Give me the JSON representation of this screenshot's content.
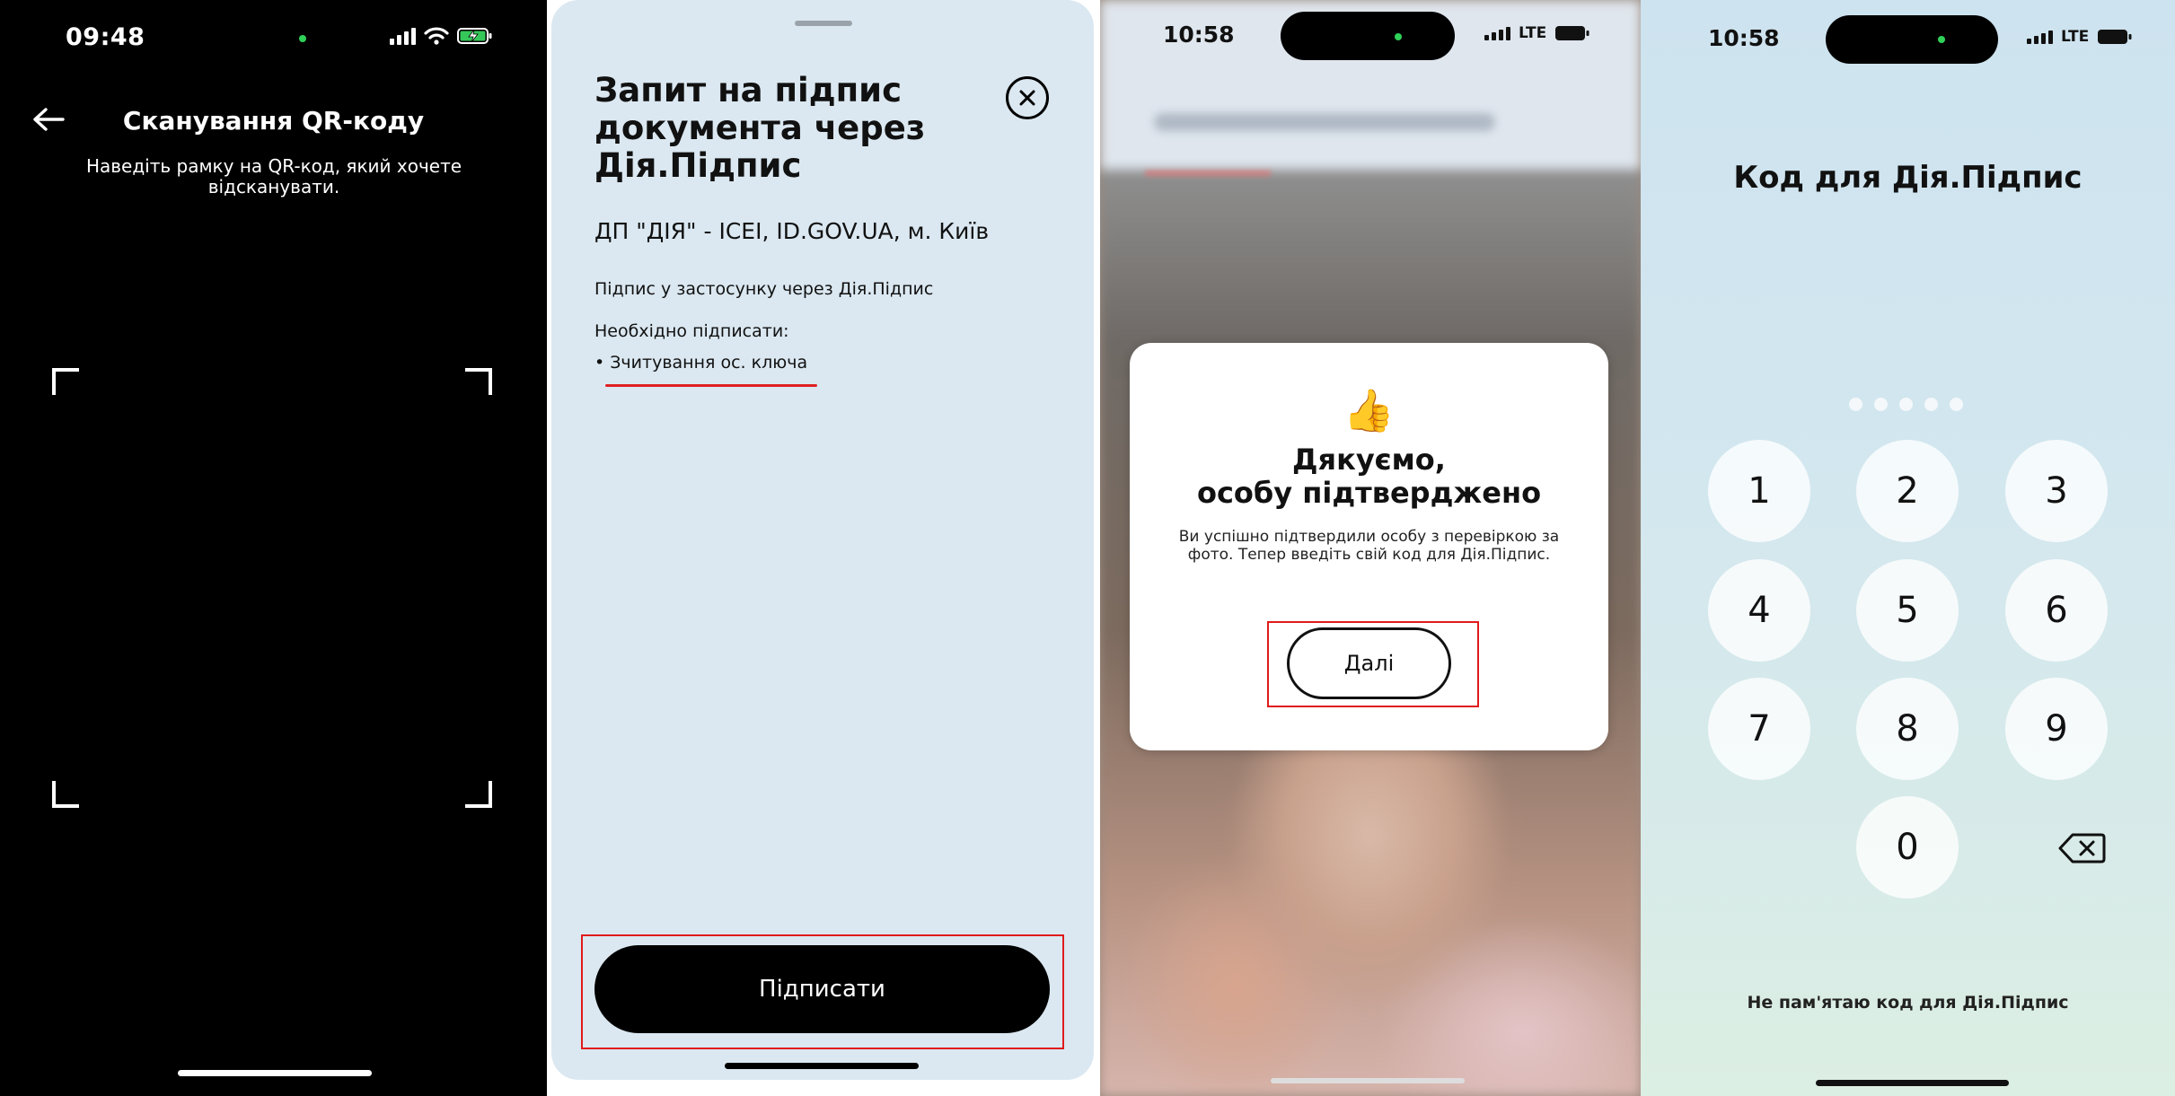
{
  "scan_screen": {
    "time": "09:48",
    "title": "Сканування QR-коду",
    "hint": "Наведіть рамку на QR-код, який хочете відсканувати.",
    "icons": {
      "back": "arrow-left-icon",
      "signal": "signal-icon",
      "wifi": "wifi-icon",
      "battery": "battery-charging-icon"
    }
  },
  "sign_request": {
    "title": "Запит на підпис документа через Дія.Підпис",
    "organization": "ДП \"ДІЯ\" - ICEI, ID.GOV.UA, м. Київ",
    "description": "Підпис у застосунку через Дія.Підпис",
    "need_to_sign_label": "Необхідно підписати:",
    "items": [
      "• Зчитування ос. ключа"
    ],
    "sign_button": "Підписати",
    "icons": {
      "close": "close-circle-icon"
    },
    "highlight_color": "#e01b1b"
  },
  "photo_check": {
    "time": "10:58",
    "network": "LTE",
    "emoji": "👍",
    "heading_line1": "Дякуємо,",
    "heading_line2": "особу підтверджено",
    "body": "Ви успішно підтвердили особу з перевіркою за фото. Тепер введіть свій код для Дія.Підпис.",
    "next_button": "Далі"
  },
  "pin_screen": {
    "time": "10:58",
    "network": "LTE",
    "title": "Код для Дія.Підпис",
    "pin_length": 5,
    "keys": [
      "1",
      "2",
      "3",
      "4",
      "5",
      "6",
      "7",
      "8",
      "9",
      "0"
    ],
    "forgot_link": "Не пам'ятаю код для Дія.Підпис",
    "icons": {
      "delete": "backspace-icon"
    }
  }
}
